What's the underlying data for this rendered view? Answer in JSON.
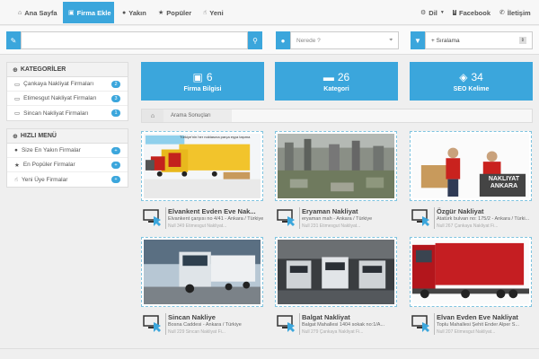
{
  "nav": {
    "items": [
      {
        "label": "Ana Sayfa",
        "icon": "home-icon"
      },
      {
        "label": "Firma Ekle",
        "icon": "briefcase-icon",
        "active": true
      },
      {
        "label": "Yakın",
        "icon": "map-marker-icon"
      },
      {
        "label": "Popüler",
        "icon": "star-icon"
      },
      {
        "label": "Yeni",
        "icon": "thumbs-up-icon"
      }
    ],
    "right": [
      {
        "label": "Dil",
        "icon": "gear-icon"
      },
      {
        "label": "Facebook",
        "icon": "facebook-icon"
      },
      {
        "label": "İletişim",
        "icon": "phone-icon"
      }
    ]
  },
  "search": {
    "query_value": "",
    "location_placeholder": "Nerede ?",
    "sort_value": "+ Sıralama"
  },
  "sidebar": {
    "categories_title": "KATEGORİLER",
    "categories": [
      {
        "label": "Çankaya Nakliyat Firmaları",
        "count": "2"
      },
      {
        "label": "Etimesgut Nakliyat Firmaları",
        "count": "3"
      },
      {
        "label": "Sincan Nakliyat Firmaları",
        "count": "1"
      }
    ],
    "quick_title": "HIZLI MENÜ",
    "quick": [
      {
        "label": "Size En Yakın Firmalar",
        "count": "+"
      },
      {
        "label": "En Popüler Firmalar",
        "count": "+"
      },
      {
        "label": "Yeni Üye Firmalar",
        "count": "+"
      }
    ]
  },
  "stats": [
    {
      "num": "6",
      "label": "Firma Bilgisi",
      "icon": "briefcase-icon"
    },
    {
      "num": "26",
      "label": "Kategori",
      "icon": "folder-icon"
    },
    {
      "num": "34",
      "label": "SEO Kelime",
      "icon": "tags-icon"
    }
  ],
  "breadcrumb": {
    "home_icon": "home-icon",
    "current": "Arama Sonuçları"
  },
  "cards": [
    {
      "title": "Elvankent Evden Eve Nak...",
      "address": "Elvankent çarşısı no 4/41 - Ankara / Türkiye",
      "meta": "Null  349  Etimesgut Nakliyat...",
      "banner": "Türkiye'nin her noktasına parça eşya taşıma"
    },
    {
      "title": "Eryaman Nakliyat",
      "address": "eryaman mah - Ankara / Türkiye",
      "meta": "Null  231  Etimesgut Nakliyat...",
      "banner": ""
    },
    {
      "title": "Özgür Nakliyat",
      "address": "Atatürk bulvarı no: 175/2 - Ankara / Türki...",
      "meta": "Null  267  Çankaya Nakliyat Fi...",
      "banner": "NAKLIYAT ANKARA"
    },
    {
      "title": "Sincan Nakliye",
      "address": "Bosna Caddesi - Ankara / Türkiye",
      "meta": "Null  229  Sincan Nakliyat Fi...",
      "banner": ""
    },
    {
      "title": "Balgat Nakliyat",
      "address": "Balgat Mahallesi 1404 sokak no:1/A...",
      "meta": "Null  279  Çankaya Nakliyat Fi...",
      "banner": ""
    },
    {
      "title": "Elvan Evden Eve Nakliyat",
      "address": "Toplu Mahallesi Şehit Ender Alper S...",
      "meta": "Null  207  Etimesgut Nakliyat...",
      "banner": ""
    }
  ],
  "colors": {
    "accent": "#3ba6dc"
  }
}
